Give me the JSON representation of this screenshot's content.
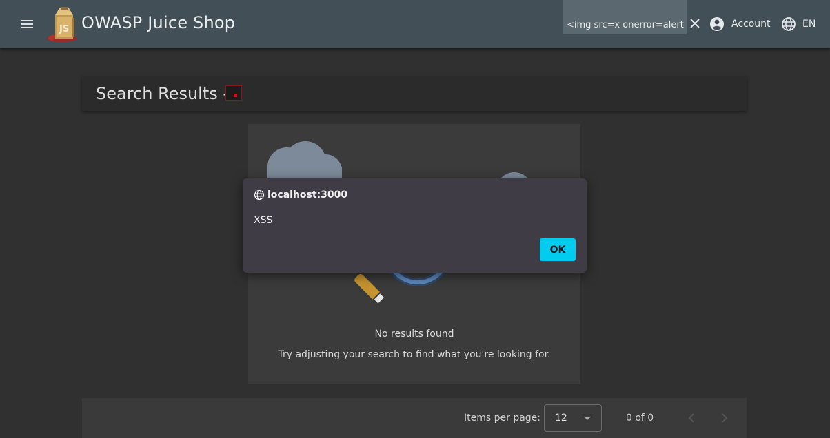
{
  "toolbar": {
    "app_title": "OWASP Juice Shop",
    "search_value": "<img src=x onerror=alert",
    "account_label": "Account",
    "language_label": "EN"
  },
  "heading": {
    "title": "Search Results -"
  },
  "results": {
    "title": "No results found",
    "subtitle": "Try adjusting your search to find what you're looking for."
  },
  "paginator": {
    "items_per_page_label": "Items per page:",
    "items_per_page_value": "12",
    "range_label": "0 of 0"
  },
  "dialog": {
    "origin": "localhost:3000",
    "message": "XSS",
    "ok_label": "OK"
  },
  "colors": {
    "toolbar": "#424f57",
    "background": "#303030",
    "dialog": "#403c46",
    "ok_button": "#00ccf0"
  }
}
